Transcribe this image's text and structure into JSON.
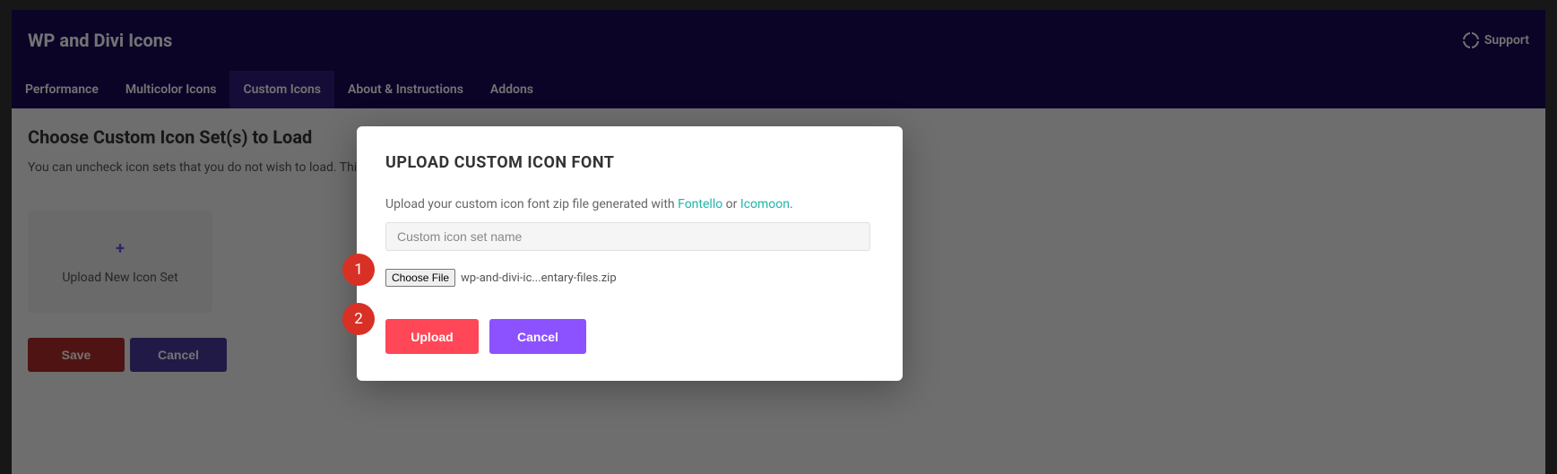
{
  "header": {
    "title": "WP and Divi Icons",
    "support_label": "Support"
  },
  "tabs": [
    {
      "label": "Performance",
      "active": false
    },
    {
      "label": "Multicolor Icons",
      "active": false
    },
    {
      "label": "Custom Icons",
      "active": true
    },
    {
      "label": "About & Instructions",
      "active": false
    },
    {
      "label": "Addons",
      "active": false
    }
  ],
  "section": {
    "title": "Choose Custom Icon Set(s) to Load",
    "desc_visible": "You can uncheck icon sets that you do not wish to load. This ca"
  },
  "upload_card": {
    "label": "Upload New Icon Set"
  },
  "page_buttons": {
    "save": "Save",
    "cancel": "Cancel"
  },
  "modal": {
    "title": "UPLOAD CUSTOM ICON FONT",
    "desc_pre": "Upload your custom icon font zip file generated with ",
    "link1": "Fontello",
    "desc_mid": " or ",
    "link2": "Icomoon",
    "desc_post": ".",
    "name_placeholder": "Custom icon set name",
    "choose_file_label": "Choose File",
    "file_name": "wp-and-divi-ic...entary-files.zip",
    "upload_label": "Upload",
    "cancel_label": "Cancel"
  },
  "annotations": {
    "step1": "1",
    "step2": "2"
  }
}
